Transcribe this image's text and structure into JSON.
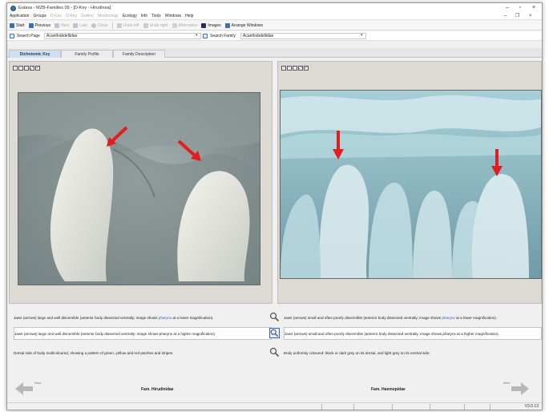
{
  "window": {
    "title": "Eutaxa - MZB-Families 09 - [D-Key - Hirudinea]"
  },
  "menu": [
    "Application",
    "Groups",
    "D-Key",
    "O-Key",
    "Gallery",
    "Morphology",
    "Ecology",
    "Info",
    "Tools",
    "Windows",
    "Help"
  ],
  "toolbar": {
    "start": "Start",
    "previous": "Previous",
    "next": "Next",
    "last": "Last",
    "close": "Close",
    "undo": "Undo left",
    "redo": "Undo right",
    "alternative": "Alternative",
    "images": "Images",
    "arrange": "Arrange Windows"
  },
  "search": {
    "page_label": "Search Page",
    "page_value": "Acanthobdellidae",
    "family_label": "Search Family",
    "family_value": "Acanthobdellidae"
  },
  "tabs": [
    "Dichotomic Key",
    "Family Profile",
    "Family Description"
  ],
  "image_tools": [
    "+",
    "−",
    "□",
    "⤢",
    "↶"
  ],
  "descriptions": {
    "left": [
      {
        "pre": "Jaws (arrows) large and well discernible (anterior body dissected ventrally; image shows ",
        "link": "pharynx",
        "post": " at a lower magnification)."
      },
      {
        "pre": "Jaws (arrows) large and well discernible (anterior body dissected ventrally; image shows pharynx at a higher magnification).",
        "link": "",
        "post": ""
      },
      {
        "pre": "Dorsal side of body multicoloured, showing a pattern of green, yellow and red patches and stripes.",
        "link": "",
        "post": ""
      }
    ],
    "right": [
      {
        "pre": "Jaws (arrows) small and often poorly discernible (anterior body dissected ventrally; image shows ",
        "link": "pharynx",
        "post": " at a lower magnification)."
      },
      {
        "pre": "Jaws (arrows) small and often poorly discernible (anterior body dissected ventrally; image shows pharynx at a higher magnification).",
        "link": "",
        "post": ""
      },
      {
        "pre": "Body uniformly coloured: black or dark grey on its dorsal, and light grey on its ventral side.",
        "link": "",
        "post": ""
      }
    ]
  },
  "nav": {
    "left_label": "Next",
    "right_label": "Next"
  },
  "families": {
    "left": "Fam. Hirudinidae",
    "right": "Fam. Haemopidae"
  },
  "status": {
    "version": "V3.0.13"
  },
  "colors": {
    "arrow": "#e21d1d",
    "link": "#2a64c4",
    "tab_active": "#cfe0f3"
  }
}
